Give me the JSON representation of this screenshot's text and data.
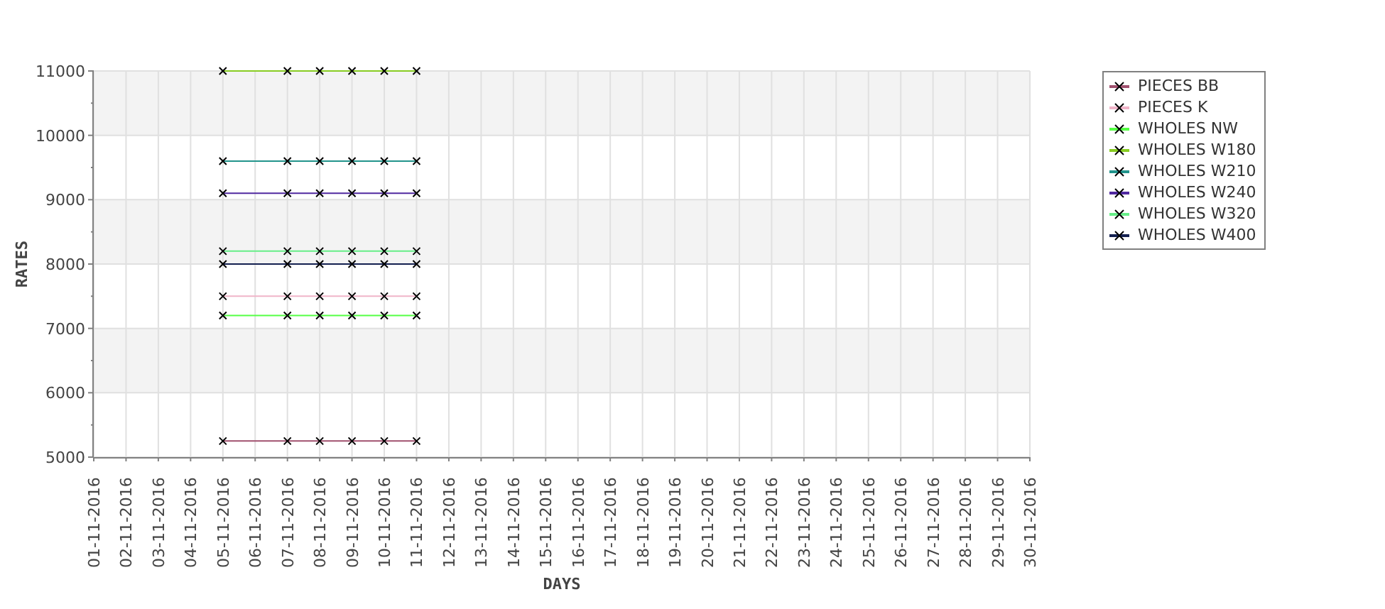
{
  "chart": {
    "chart_data": {
      "type": "line",
      "grid": true,
      "xlabel": "DAYS",
      "ylabel": "RATES",
      "categories": [
        "01-11-2016",
        "02-11-2016",
        "03-11-2016",
        "04-11-2016",
        "05-11-2016",
        "06-11-2016",
        "07-11-2016",
        "08-11-2016",
        "09-11-2016",
        "10-11-2016",
        "11-11-2016",
        "12-11-2016",
        "13-11-2016",
        "14-11-2016",
        "15-11-2016",
        "16-11-2016",
        "17-11-2016",
        "18-11-2016",
        "19-11-2016",
        "20-11-2016",
        "21-11-2016",
        "22-11-2016",
        "23-11-2016",
        "24-11-2016",
        "25-11-2016",
        "26-11-2016",
        "27-11-2016",
        "28-11-2016",
        "29-11-2016",
        "30-11-2016"
      ],
      "ylim": [
        5000,
        11000
      ],
      "yticks": [
        5000,
        6000,
        7000,
        8000,
        9000,
        10000,
        11000
      ],
      "series": [
        {
          "name": "PIECES BB",
          "color": "#a0506e",
          "marker": "x",
          "values": [
            null,
            null,
            null,
            null,
            5250,
            null,
            5250,
            5250,
            5250,
            5250,
            5250,
            null,
            null,
            null,
            null,
            null,
            null,
            null,
            null,
            null,
            null,
            null,
            null,
            null,
            null,
            null,
            null,
            null,
            null,
            null
          ]
        },
        {
          "name": "PIECES K",
          "color": "#f0b4c8",
          "marker": "x",
          "values": [
            null,
            null,
            null,
            null,
            7500,
            null,
            7500,
            7500,
            7500,
            7500,
            7500,
            null,
            null,
            null,
            null,
            null,
            null,
            null,
            null,
            null,
            null,
            null,
            null,
            null,
            null,
            null,
            null,
            null,
            null,
            null
          ]
        },
        {
          "name": "WHOLES NW",
          "color": "#55ff44",
          "marker": "x",
          "values": [
            null,
            null,
            null,
            null,
            7200,
            null,
            7200,
            7200,
            7200,
            7200,
            7200,
            null,
            null,
            null,
            null,
            null,
            null,
            null,
            null,
            null,
            null,
            null,
            null,
            null,
            null,
            null,
            null,
            null,
            null,
            null
          ]
        },
        {
          "name": "WHOLES W180",
          "color": "#88cc22",
          "marker": "x",
          "values": [
            null,
            null,
            null,
            null,
            11000,
            null,
            11000,
            11000,
            11000,
            11000,
            11000,
            null,
            null,
            null,
            null,
            null,
            null,
            null,
            null,
            null,
            null,
            null,
            null,
            null,
            null,
            null,
            null,
            null,
            null,
            null
          ]
        },
        {
          "name": "WHOLES W210",
          "color": "#22948c",
          "marker": "x",
          "values": [
            null,
            null,
            null,
            null,
            9600,
            null,
            9600,
            9600,
            9600,
            9600,
            9600,
            null,
            null,
            null,
            null,
            null,
            null,
            null,
            null,
            null,
            null,
            null,
            null,
            null,
            null,
            null,
            null,
            null,
            null,
            null
          ]
        },
        {
          "name": "WHOLES W240",
          "color": "#5028a0",
          "marker": "x",
          "values": [
            null,
            null,
            null,
            null,
            9100,
            null,
            9100,
            9100,
            9100,
            9100,
            9100,
            null,
            null,
            null,
            null,
            null,
            null,
            null,
            null,
            null,
            null,
            null,
            null,
            null,
            null,
            null,
            null,
            null,
            null,
            null
          ]
        },
        {
          "name": "WHOLES W320",
          "color": "#66ee88",
          "marker": "x",
          "values": [
            null,
            null,
            null,
            null,
            8200,
            null,
            8200,
            8200,
            8200,
            8200,
            8200,
            null,
            null,
            null,
            null,
            null,
            null,
            null,
            null,
            null,
            null,
            null,
            null,
            null,
            null,
            null,
            null,
            null,
            null,
            null
          ]
        },
        {
          "name": "WHOLES W400",
          "color": "#142050",
          "marker": "x",
          "values": [
            null,
            null,
            null,
            null,
            8000,
            null,
            8000,
            8000,
            8000,
            8000,
            8000,
            null,
            null,
            null,
            null,
            null,
            null,
            null,
            null,
            null,
            null,
            null,
            null,
            null,
            null,
            null,
            null,
            null,
            null,
            null
          ]
        }
      ]
    }
  }
}
